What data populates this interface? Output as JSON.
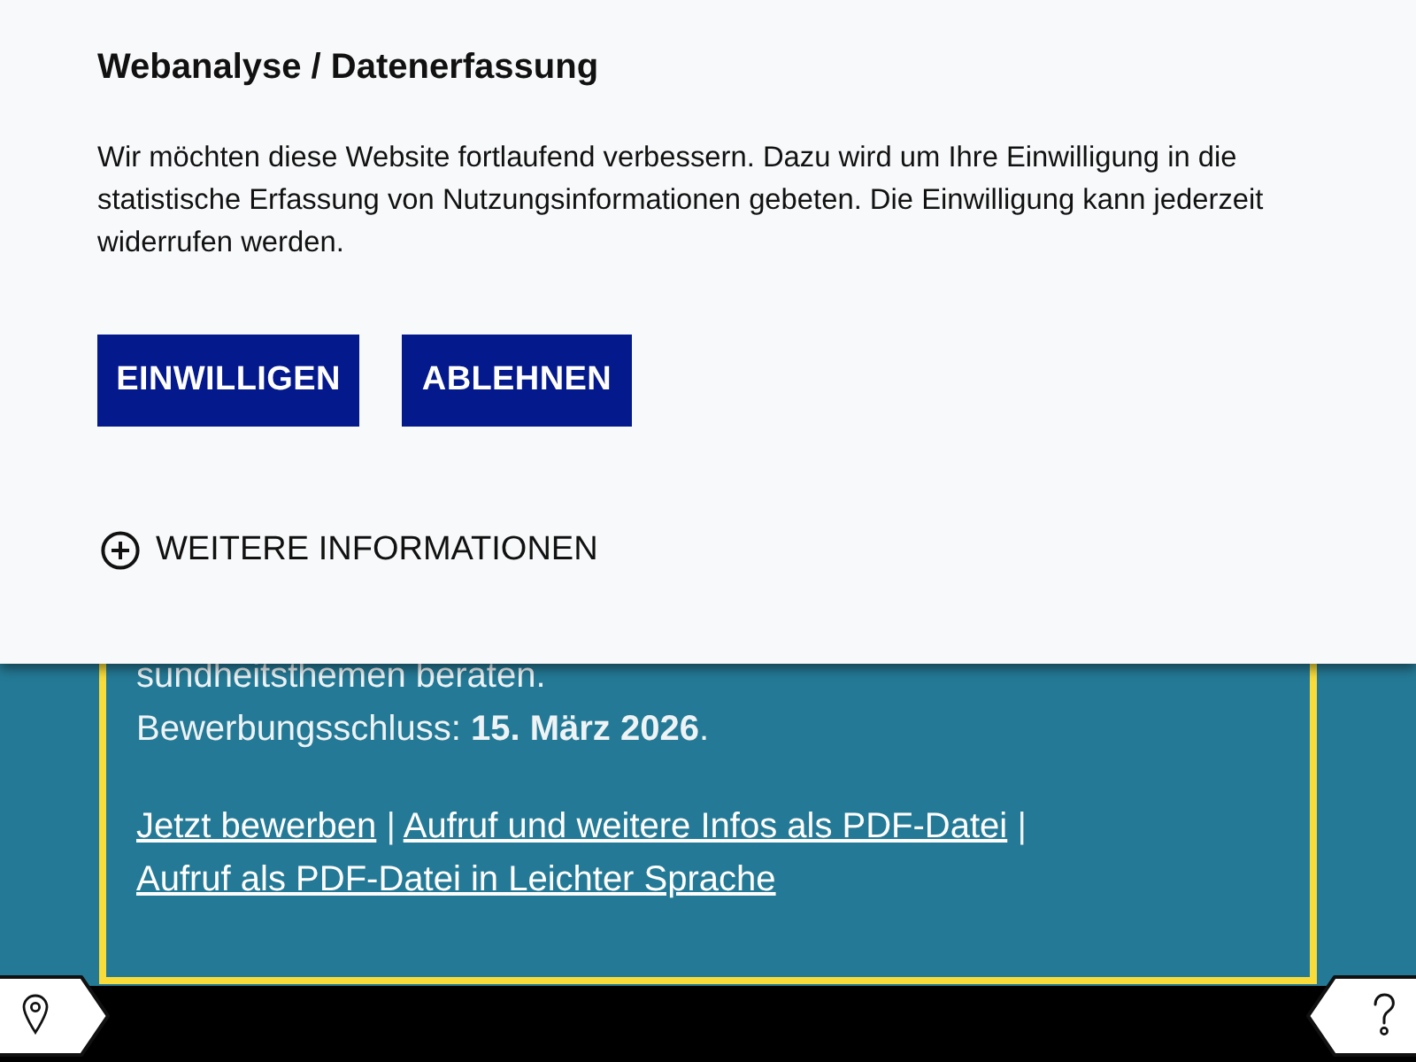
{
  "cookie_banner": {
    "title": "Webanalyse / Datenerfassung",
    "text": "Wir möchten diese Website fortlaufend verbessern. Dazu wird um Ihre Einwilligung in die statistische Erfassung von Nutzungsinformationen gebeten. Die Einwilligung kann jederzeit widerrufen werden.",
    "buttons": [
      {
        "label": "EINWILLIGEN"
      },
      {
        "label": "ABLEHNEN"
      }
    ],
    "more_info": {
      "label": "WEITERE INFORMATIONEN",
      "expanded": false
    }
  },
  "notice": {
    "paragraphs": [
      "sundheitsthemen beraten.",
      "Bewerbungsschluss: **15. März 2026**."
    ],
    "links": [
      {
        "kind": "link",
        "text": "Jetzt bewerben"
      },
      {
        "kind": "separator",
        "text": "|"
      },
      {
        "kind": "link",
        "text": "Aufruf und weitere Infos als PDF-Datei"
      },
      {
        "kind": "separator",
        "text": "|"
      },
      {
        "kind": "link",
        "text": "Aufruf als PDF-Datei in Leichter Sprache"
      }
    ]
  }
}
